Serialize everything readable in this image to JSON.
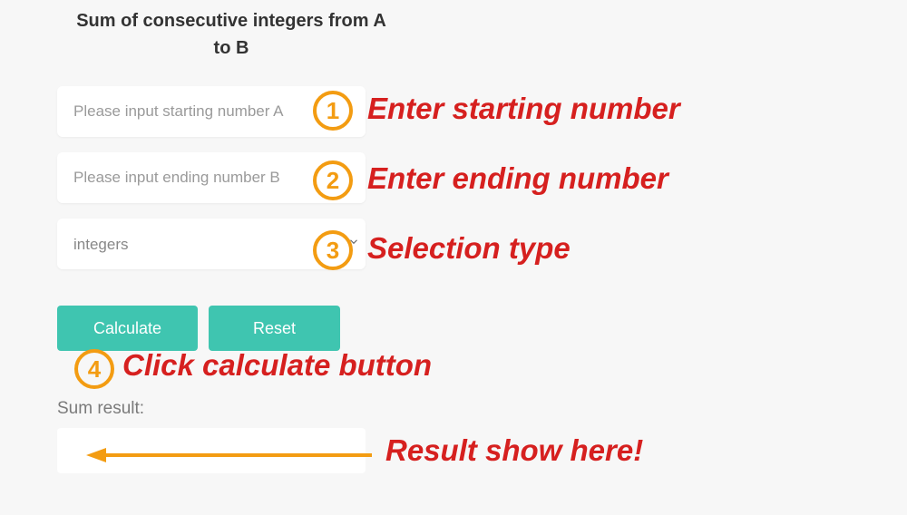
{
  "title": "Sum of consecutive integers from A to B",
  "inputs": {
    "startPlaceholder": "Please input starting number A",
    "endPlaceholder": "Please input ending number B",
    "typeValue": "integers"
  },
  "buttons": {
    "calculate": "Calculate",
    "reset": "Reset"
  },
  "resultLabel": "Sum result:",
  "annotations": {
    "badges": {
      "n1": "1",
      "n2": "2",
      "n3": "3",
      "n4": "4"
    },
    "texts": {
      "t1": "Enter starting number",
      "t2": "Enter ending number",
      "t3": "Selection type",
      "t4": "Click calculate button",
      "t5": "Result show here!"
    }
  }
}
